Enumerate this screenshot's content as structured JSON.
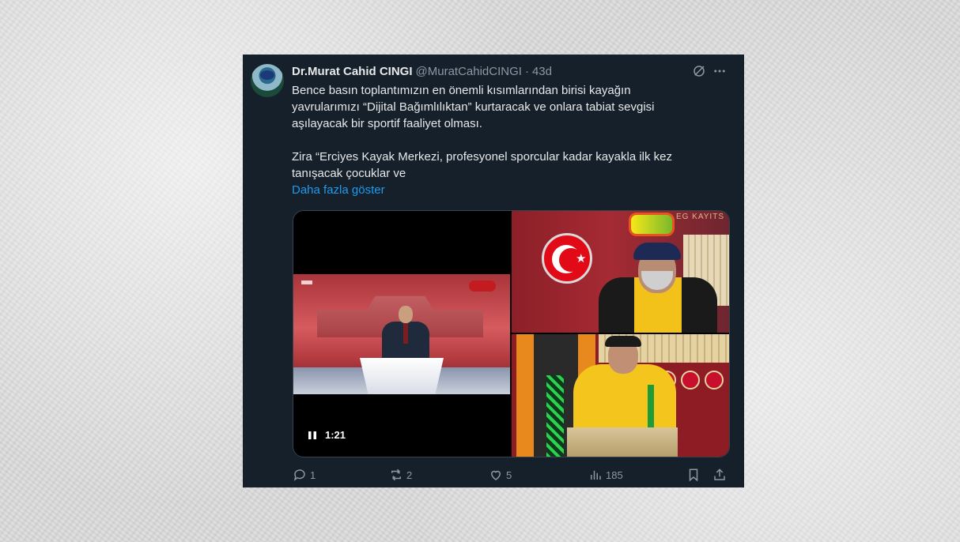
{
  "tweet": {
    "author_name": "Dr.Murat Cahid CINGI",
    "handle": "@MuratCahidCINGI",
    "separator": "·",
    "time": "43d",
    "paragraphs": [
      "Bence basın toplantımızın en önemli kısımlarından birisi kayağın\nyavrularımızı “Dijital Bağımlılıktan” kurtaracak ve onlara tabiat sevgisi\naşılayacak bir sportif faaliyet olması.",
      "Zira “Erciyes Kayak Merkezi, profesyonel sporcular kadar kayakla ilk kez\ntanışacak çocuklar ve"
    ],
    "show_more": "Daha fazla göster",
    "icons": {
      "grok": "grok-icon",
      "more": "more-horizontal-icon"
    }
  },
  "media": {
    "video_time": "1:21",
    "video_state": "playing",
    "banner_text": "EG   KAYITS"
  },
  "actions": {
    "replies": "1",
    "reposts": "2",
    "likes": "5",
    "views": "185"
  },
  "colors": {
    "background": "#15202b",
    "text": "#e7e9ea",
    "muted": "#8b98a5",
    "link": "#1d9bf0"
  }
}
